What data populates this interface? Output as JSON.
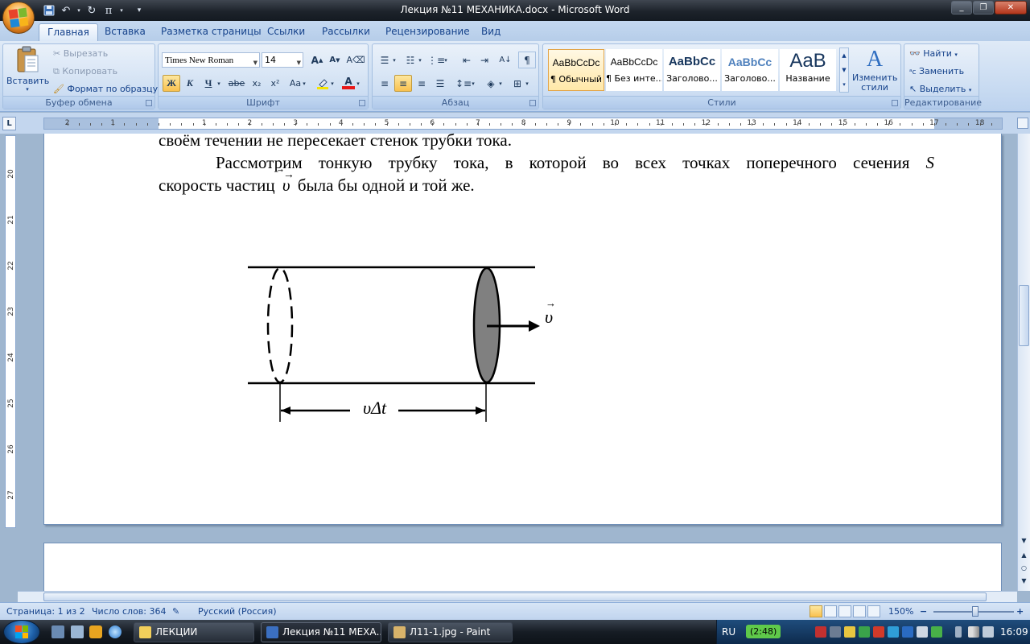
{
  "window": {
    "title": "Лекция №11 МЕХАНИКА.docx - Microsoft Word",
    "minimize": "_",
    "maximize": "❐",
    "close": "✕"
  },
  "tabs": [
    "Главная",
    "Вставка",
    "Разметка страницы",
    "Ссылки",
    "Рассылки",
    "Рецензирование",
    "Вид"
  ],
  "ribbon": {
    "clipboard": {
      "label": "Буфер обмена",
      "paste": "Вставить",
      "cut": "Вырезать",
      "copy": "Копировать",
      "format_painter": "Формат по образцу"
    },
    "font": {
      "label": "Шрифт",
      "font_name": "Times New Roman",
      "font_size": "14",
      "bold": "Ж",
      "italic": "К",
      "underline": "Ч",
      "strike": "abe",
      "subscript": "x₂",
      "superscript": "x²",
      "change_case": "Aa",
      "grow": "A",
      "shrink": "A",
      "font_color": "A"
    },
    "paragraph": {
      "label": "Абзац"
    },
    "styles": {
      "label": "Стили",
      "items": [
        {
          "sample": "AaBbCcDc",
          "name": "¶ Обычный"
        },
        {
          "sample": "AaBbCcDc",
          "name": "¶ Без инте..."
        },
        {
          "sample": "AaBbCc",
          "name": "Заголово..."
        },
        {
          "sample": "AaBbCc",
          "name": "Заголово..."
        },
        {
          "sample": "AaB",
          "name": "Название"
        }
      ],
      "change_styles": "Изменить стили"
    },
    "editing": {
      "label": "Редактирование",
      "find": "Найти",
      "replace": "Заменить",
      "select": "Выделить"
    }
  },
  "ruler": {
    "h_numbers": [
      "2",
      "1",
      "1",
      "2",
      "3",
      "4",
      "5",
      "6",
      "7",
      "8",
      "9",
      "10",
      "11",
      "12",
      "13",
      "14",
      "15",
      "16",
      "17",
      "18"
    ],
    "v_numbers": [
      "20",
      "21",
      "22",
      "23",
      "24",
      "25",
      "26",
      "27"
    ],
    "corner": "L"
  },
  "document": {
    "line1": "своём течении не пересекает стенок трубки тока.",
    "line2": "Рассмотрим тонкую трубку тока, в которой во всех точках поперечного сечения",
    "line2_var": "S",
    "line3_a": "скорость частиц",
    "line3_var": "υ",
    "line3_b": "была бы одной и той же.",
    "figure": {
      "velocity_label": "υ",
      "length_label_v": "υΔt"
    }
  },
  "status": {
    "page": "Страница: 1 из 2",
    "words": "Число слов: 364",
    "language": "Русский (Россия)",
    "zoom": "150%",
    "zoom_minus": "−",
    "zoom_plus": "+"
  },
  "taskbar": {
    "tasks": [
      "ЛЕКЦИИ",
      "Лекция №11 МЕХА...",
      "Л11-1.jpg - Paint"
    ],
    "lang": "RU",
    "battery": "(2:48)",
    "clock": "16:09"
  },
  "colors": {
    "accent": "#15428b",
    "highlight": "#f9c14f"
  }
}
